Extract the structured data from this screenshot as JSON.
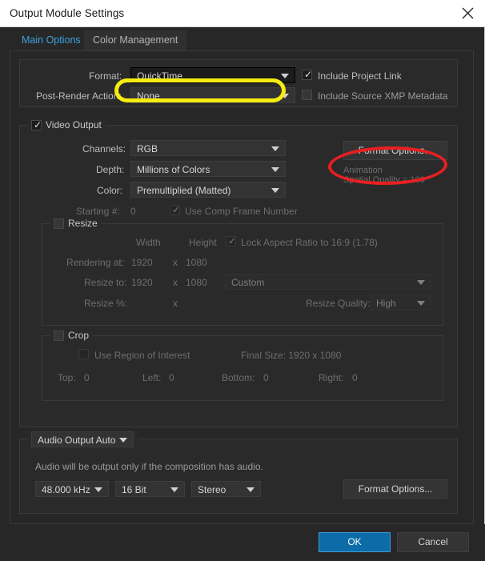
{
  "window": {
    "title": "Output Module Settings",
    "close_icon": "close-icon"
  },
  "tabs": [
    {
      "label": "Main Options",
      "active": true
    },
    {
      "label": "Color Management",
      "active": false
    }
  ],
  "format_group": {
    "format_label": "Format:",
    "format_value": "QuickTime",
    "post_render_label": "Post-Render Action:",
    "post_render_value": "None",
    "include_project_link_label": "Include Project Link",
    "include_project_link_checked": "✓",
    "include_xmp_label": "Include Source XMP Metadata"
  },
  "video_output": {
    "legend": "Video Output",
    "legend_checked": "✓",
    "channels_label": "Channels:",
    "channels_value": "RGB",
    "depth_label": "Depth:",
    "depth_value": "Millions of Colors",
    "color_label": "Color:",
    "color_value": "Premultiplied (Matted)",
    "starting_num_label": "Starting #:",
    "starting_num_value": "0",
    "use_comp_frame_label": "Use Comp Frame Number",
    "use_comp_frame_checked": "✓",
    "format_options_label": "Format Options...",
    "codec_name": "Animation",
    "spatial_quality": "Spatial Quality = 100"
  },
  "resize": {
    "legend": "Resize",
    "width_header": "Width",
    "height_header": "Height",
    "lock_aspect_label": "Lock Aspect Ratio to 16:9 (1.78)",
    "lock_aspect_checked": "✓",
    "rendering_at_label": "Rendering at:",
    "rendering_at_width": "1920",
    "rendering_at_x": "x",
    "rendering_at_height": "1080",
    "resize_to_label": "Resize to:",
    "resize_to_width": "1920",
    "resize_to_x": "x",
    "resize_to_height": "1080",
    "resize_preset": "Custom",
    "resize_pct_label": "Resize %:",
    "resize_pct_x": "x",
    "resize_quality_label": "Resize Quality:",
    "resize_quality_value": "High"
  },
  "crop": {
    "legend": "Crop",
    "use_roi_label": "Use Region of Interest",
    "final_size_label": "Final Size: 1920 x 1080",
    "top_label": "Top:",
    "top_value": "0",
    "left_label": "Left:",
    "left_value": "0",
    "bottom_label": "Bottom:",
    "bottom_value": "0",
    "right_label": "Right:",
    "right_value": "0"
  },
  "audio": {
    "legend": "Audio Output Auto",
    "note": "Audio will be output only if the composition has audio.",
    "sample_rate": "48.000 kHz",
    "bit_depth": "16 Bit",
    "channels": "Stereo",
    "format_options_label": "Format Options..."
  },
  "footer": {
    "ok_label": "OK",
    "cancel_label": "Cancel"
  },
  "annotations": {
    "yellow_highlight_color": "#f5ed10",
    "red_highlight_color": "#e81f20",
    "yellow_target": "format-dropdown",
    "red_target": "video-format-options-button"
  }
}
